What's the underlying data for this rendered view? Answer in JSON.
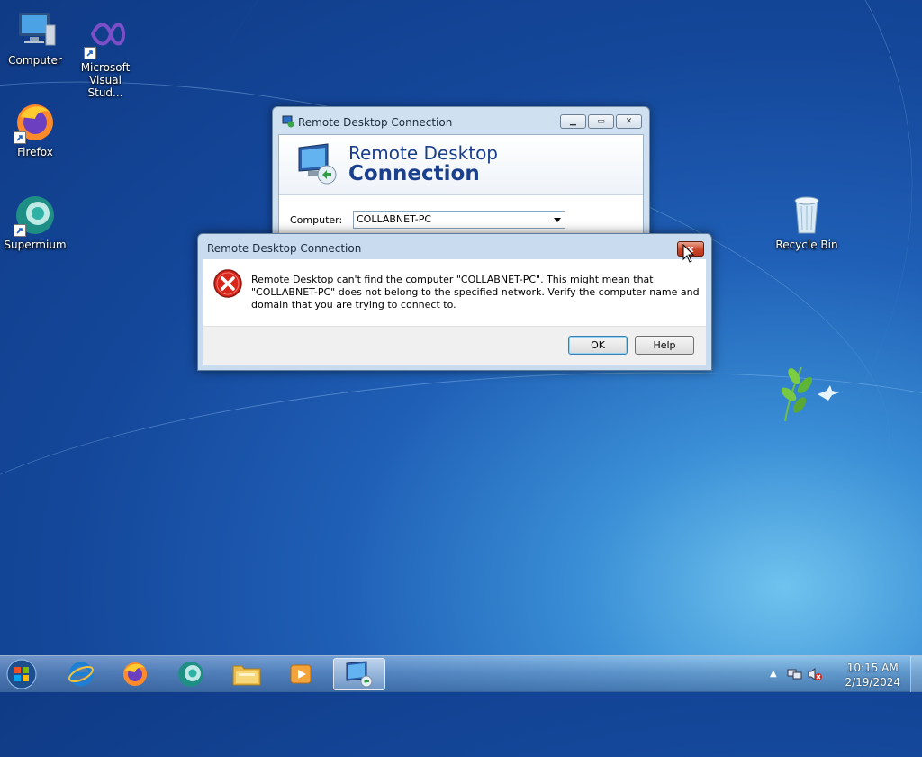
{
  "desktop": {
    "icons": [
      {
        "label": "Computer"
      },
      {
        "label": "Microsoft Visual Stud..."
      },
      {
        "label": "Firefox"
      },
      {
        "label": "Supermium"
      },
      {
        "label": "Recycle Bin"
      }
    ]
  },
  "rdc_window": {
    "title": "Remote Desktop Connection",
    "banner_line1": "Remote Desktop",
    "banner_line2": "Connection",
    "computer_label": "Computer:",
    "computer_value": "COLLABNET-PC"
  },
  "error_dialog": {
    "title": "Remote Desktop Connection",
    "close_label": "x",
    "message": "Remote Desktop can't find the computer \"COLLABNET-PC\". This might mean that\n\"COLLABNET-PC\" does not belong to the specified network.  Verify the computer name and\ndomain that you are trying to connect to.",
    "ok_label": "OK",
    "help_label": "Help"
  },
  "taskbar": {
    "items": [
      "Internet Explorer",
      "Firefox",
      "Supermium",
      "Windows Explorer",
      "Windows Media Player",
      "Remote Desktop Connection"
    ],
    "time": "10:15 AM",
    "date": "2/19/2024"
  },
  "colors": {
    "banner_text": "#1a3f8c",
    "close_button": "#c9462b",
    "error_icon": "#d9261c"
  }
}
